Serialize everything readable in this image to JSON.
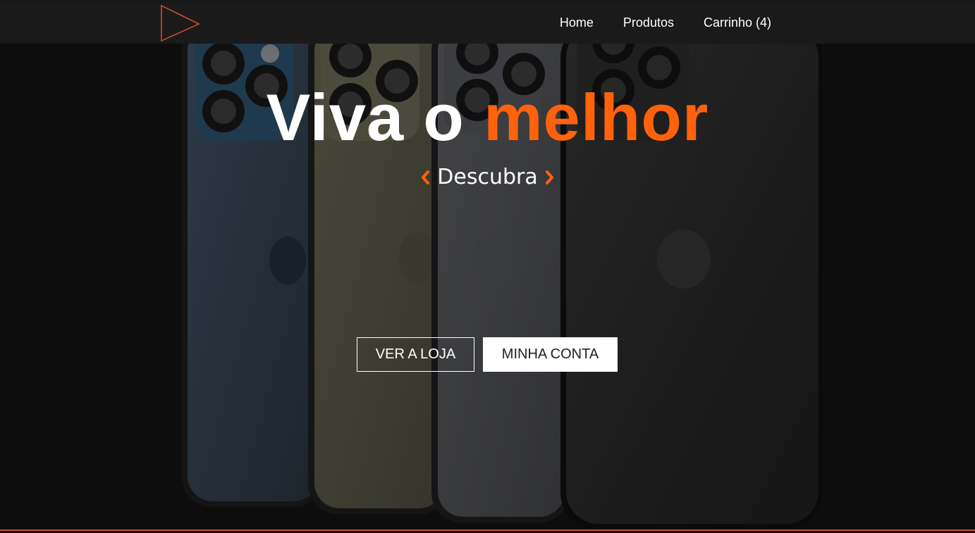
{
  "nav": {
    "logo_icon": "play-triangle-icon",
    "links": [
      "Home",
      "Produtos",
      "Carrinho (4)"
    ]
  },
  "hero": {
    "title_part1": "Viva o ",
    "title_accent": "melhor",
    "discover_label": "Descubra",
    "prev_icon": "chevron-left-icon",
    "next_icon": "chevron-right-icon"
  },
  "buttons": {
    "store": "VER A LOJA",
    "account": "MINHA CONTA"
  },
  "colors": {
    "accent": "#ff620d",
    "navbar": "#1b1a1a",
    "background": "#0d0d0d"
  }
}
